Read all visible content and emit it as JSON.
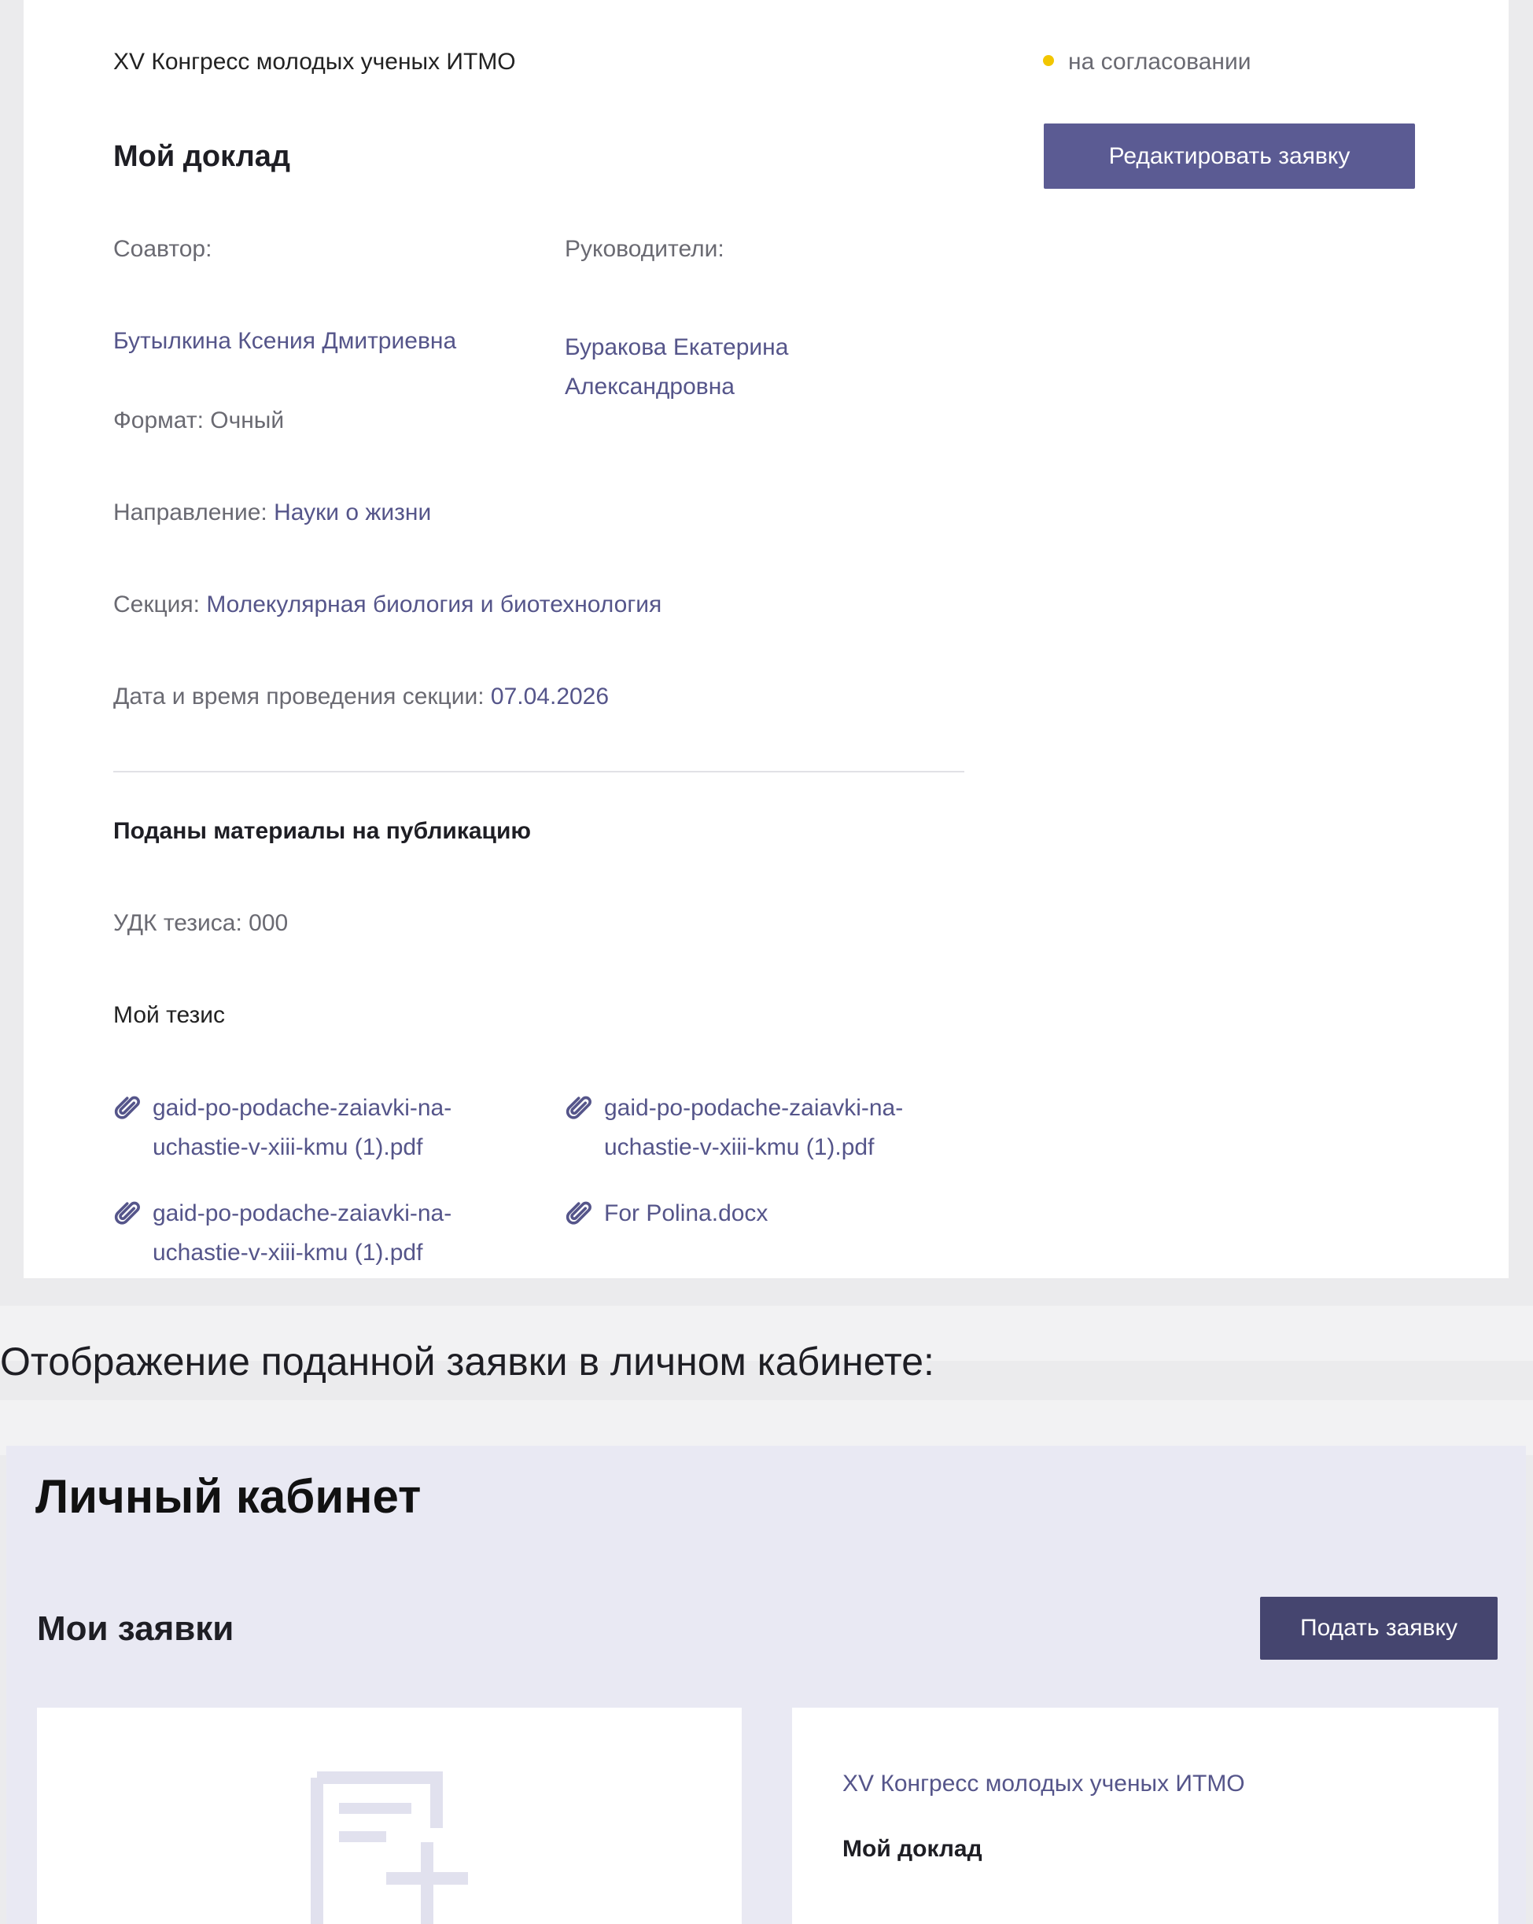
{
  "request": {
    "conference": "XV Конгресс молодых ученых ИТМО",
    "status": "на согласовании",
    "status_color": "#f2c600",
    "title": "Мой доклад",
    "edit_button": "Редактировать заявку",
    "coauthor_label": "Соавтор:",
    "supervisors_label": "Руководители:",
    "coauthor": "Бутылкина Ксения Дмитриевна",
    "supervisor": "Буракова Екатерина Александровна",
    "format_label": "Формат:",
    "format": "Очный",
    "direction_label": "Направление:",
    "direction": "Науки о жизни",
    "section_label": "Секция:",
    "section": "Молекулярная биология и биотехнология",
    "datetime_label": "Дата и время проведения секции:",
    "datetime": "07.04.2026",
    "materials_title": "Поданы материалы на публикацию",
    "udk_label": "УДК тезиса:",
    "udk": "000",
    "thesis_title": "Мой тезис",
    "files": [
      {
        "name": "gaid-po-podache-zaiavki-na-uchastie-v-xiii-kmu (1).pdf",
        "icon": "paperclip-icon"
      },
      {
        "name": "gaid-po-podache-zaiavki-na-uchastie-v-xiii-kmu (1).pdf",
        "icon": "paperclip-icon"
      },
      {
        "name": "gaid-po-podache-zaiavki-na-uchastie-v-xiii-kmu (1).pdf",
        "icon": "paperclip-icon"
      },
      {
        "name": "For Polina.docx",
        "icon": "paperclip-icon"
      }
    ]
  },
  "caption": "Отображение поданной заявки в личном кабинете:",
  "cabinet": {
    "title": "Личный кабинет",
    "applications_title": "Мои заявки",
    "submit_button": "Подать заявку",
    "new_card_icon": "add-document-icon",
    "card": {
      "conference": "XV Конгресс молодых ученых ИТМО",
      "title": "Мой доклад"
    }
  },
  "colors": {
    "accent_button": "#5b5b93",
    "dark_button": "#45456f",
    "link_text": "#55558a",
    "panel_bg": "#e9e9f3"
  }
}
